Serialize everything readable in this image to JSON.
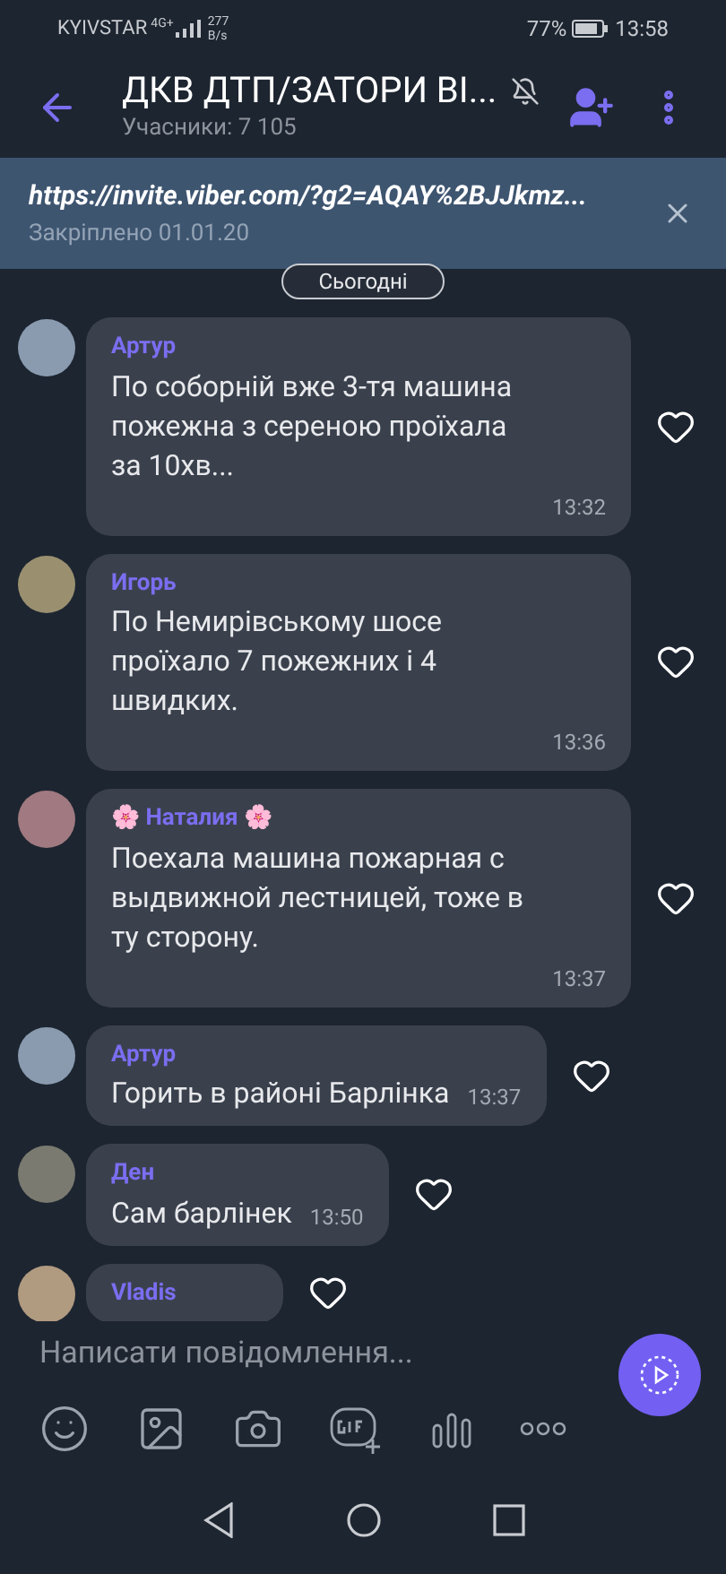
{
  "status_bar": {
    "carrier": "KYIVSTAR",
    "network": "4G+",
    "speed": "277",
    "speed_unit": "B/s",
    "battery": "77%",
    "time": "13:58"
  },
  "header": {
    "title": "ДКВ ДТП/ЗАТОРИ ВІ...",
    "subtitle": "Учасники: 7 105",
    "muted": true
  },
  "pinned": {
    "link": "https://invite.viber.com/?g2=AQAY%2BJJkmz...",
    "note": "Закріплено 01.01.20"
  },
  "date_pill": "Сьогодні",
  "messages": [
    {
      "kind": "block",
      "name": "Артур",
      "text": "По соборній вже 3-тя машина пожежна з сереною проїхала за 10хв...",
      "time": "13:32",
      "liked": false
    },
    {
      "kind": "block",
      "name": "Игорь",
      "text": "По Немирівському шосе проїхало 7 пожежних і 4 швидких.",
      "time": "13:36",
      "liked": false
    },
    {
      "kind": "block",
      "name": "🌸 Наталия 🌸",
      "text": "Поехала машина пожарная с выдвижной лестницей, тоже в ту сторону.",
      "time": "13:37",
      "liked": false
    },
    {
      "kind": "inline",
      "name": "Артур",
      "text": "Горить в районі Барлінка",
      "time": "13:37",
      "liked": false
    },
    {
      "kind": "inline",
      "name": "Ден",
      "text": "Сам барлінек",
      "time": "13:50",
      "liked": false
    },
    {
      "kind": "inline",
      "name": "Vladis",
      "liked": false
    }
  ],
  "composer": {
    "placeholder": "Написати повідомлення..."
  }
}
